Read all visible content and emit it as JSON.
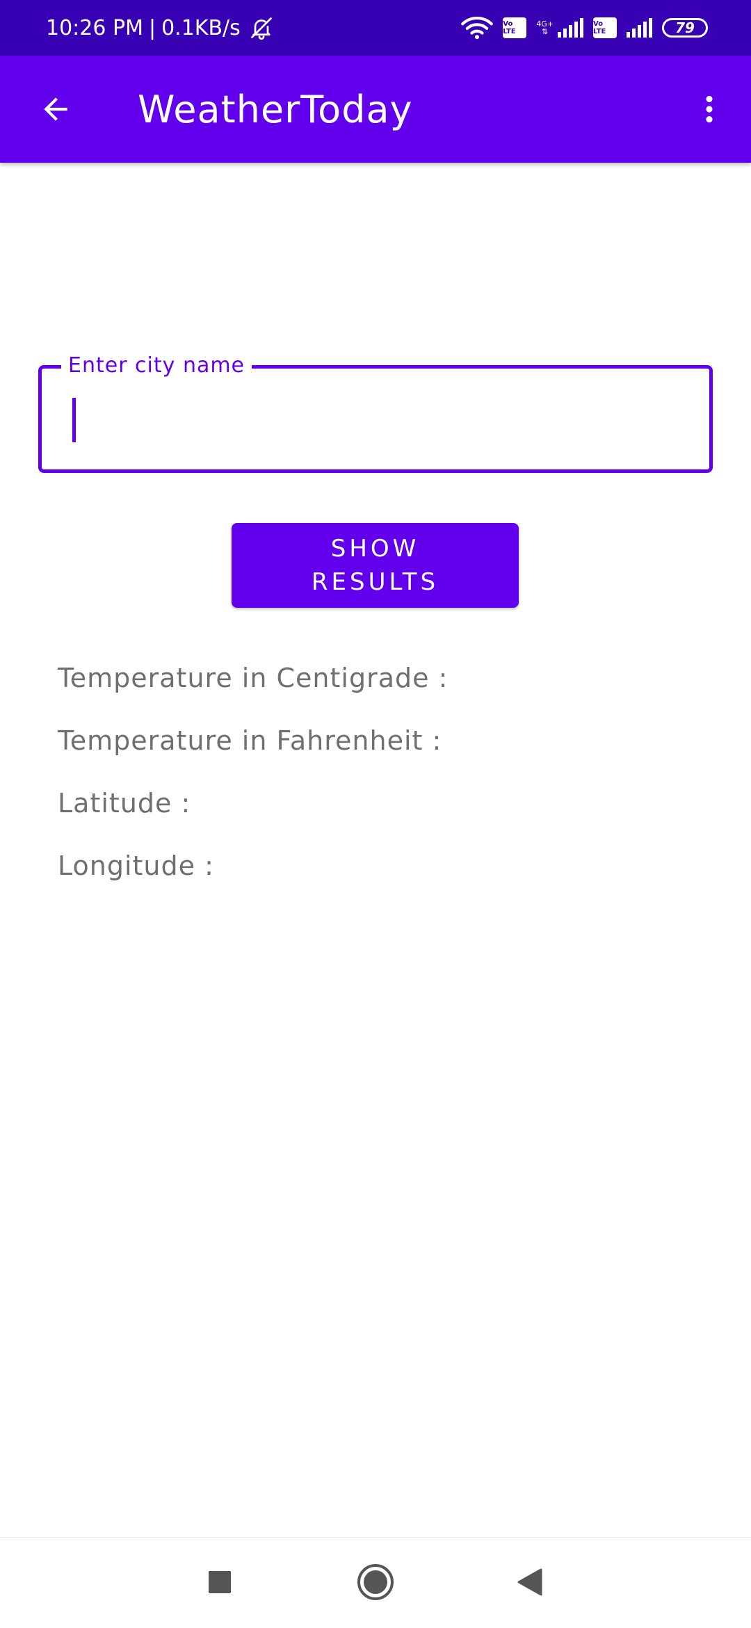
{
  "status_bar": {
    "time": "10:26 PM",
    "separator": "|",
    "speed": "0.1KB/s",
    "volte_1": "Vo LTE",
    "net_type": "4G+",
    "volte_2": "Vo LTE",
    "battery": "79",
    "icons": [
      "bell-off-icon",
      "wifi-icon",
      "signal-icon",
      "signal-icon",
      "battery-icon"
    ]
  },
  "app_bar": {
    "title": "WeatherToday",
    "back_icon": "arrow-back-icon",
    "menu_icon": "more-vert-icon"
  },
  "city_input": {
    "label": "Enter city name",
    "value": ""
  },
  "show_button": {
    "label": "Show Results"
  },
  "results": {
    "centigrade": "Temperature in Centigrade :",
    "fahrenheit": "Temperature in Fahrenheit :",
    "latitude": "Latitude :",
    "longitude": "Longitude :"
  },
  "nav_bar": {
    "icons": [
      "recents-square-icon",
      "home-circle-icon",
      "back-triangle-icon"
    ]
  },
  "colors": {
    "primary": "#6200ee",
    "primary_dark": "#3700b3",
    "result_text": "#6f6f6f"
  }
}
